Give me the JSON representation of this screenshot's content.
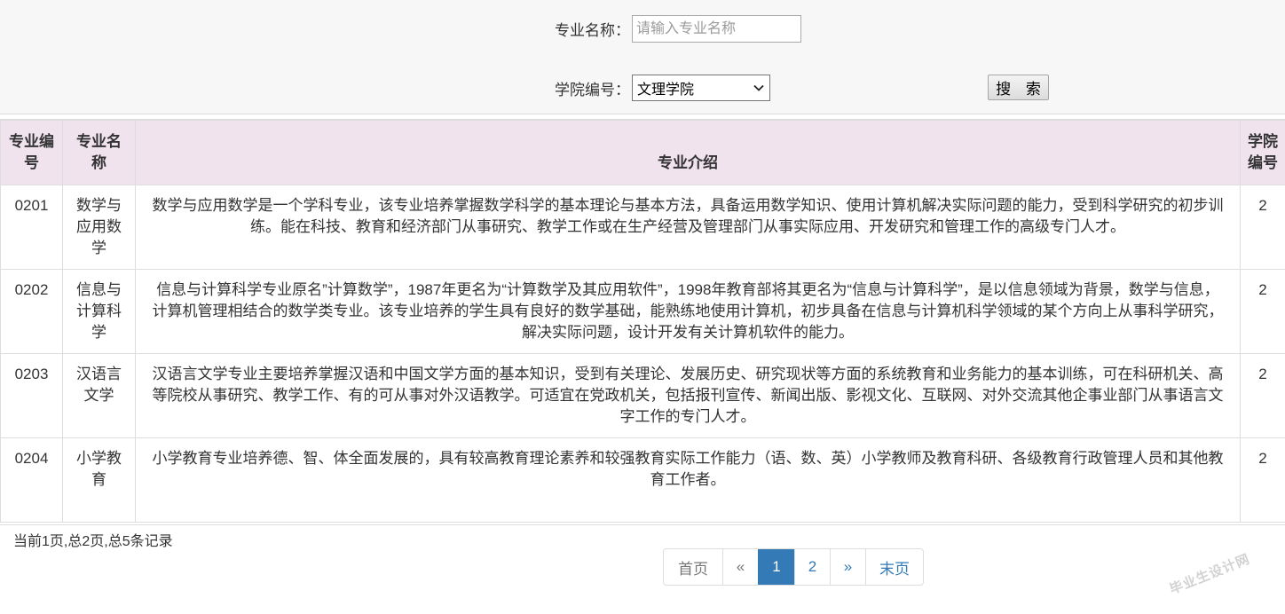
{
  "search": {
    "name_label": "专业名称：",
    "name_placeholder": "请输入专业名称",
    "college_label": "学院编号：",
    "college_selected": "文理学院",
    "search_button": "搜 索"
  },
  "table": {
    "headers": {
      "code": "专业编号",
      "name": "专业名称",
      "intro": "专业介绍",
      "college": "学院编号"
    },
    "rows": [
      {
        "code": "0201",
        "name": "数学与应用数学",
        "intro": "数学与应用数学是一个学科专业，该专业培养掌握数学科学的基本理论与基本方法，具备运用数学知识、使用计算机解决实际问题的能力，受到科学研究的初步训练。能在科技、教育和经济部门从事研究、教学工作或在生产经营及管理部门从事实际应用、开发研究和管理工作的高级专门人才。",
        "college": "2"
      },
      {
        "code": "0202",
        "name": "信息与计算科学",
        "intro": "信息与计算科学专业原名”计算数学”，1987年更名为“计算数学及其应用软件”，1998年教育部将其更名为“信息与计算科学”，是以信息领域为背景，数学与信息，计算机管理相结合的数学类专业。该专业培养的学生具有良好的数学基础，能熟练地使用计算机，初步具备在信息与计算机科学领域的某个方向上从事科学研究，解决实际问题，设计开发有关计算机软件的能力。",
        "college": "2"
      },
      {
        "code": "0203",
        "name": "汉语言文学",
        "intro": "汉语言文学专业主要培养掌握汉语和中国文学方面的基本知识，受到有关理论、发展历史、研究现状等方面的系统教育和业务能力的基本训练，可在科研机关、高等院校从事研究、教学工作、有的可从事对外汉语教学。可适宜在党政机关，包括报刊宣传、新闻出版、影视文化、互联网、对外交流其他企事业部门从事语言文字工作的专门人才。",
        "college": "2"
      },
      {
        "code": "0204",
        "name": "小学教育",
        "intro": "小学教育专业培养德、智、体全面发展的，具有较高教育理论素养和较强教育实际工作能力（语、数、英）小学教师及教育科研、各级教育行政管理人员和其他教育工作者。",
        "college": "2"
      }
    ]
  },
  "pagination": {
    "info": "当前1页,总2页,总5条记录",
    "first": "首页",
    "prev": "«",
    "current": "1",
    "page2": "2",
    "next": "»",
    "last": "末页"
  },
  "watermark": "毕业生设计网",
  "colors": {
    "header_bg": "#f0e3ee",
    "active_page": "#337ab7",
    "link": "#337ab7",
    "panel_bg": "#f7f7f7"
  }
}
